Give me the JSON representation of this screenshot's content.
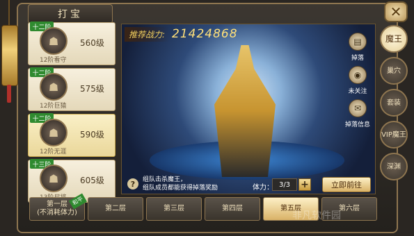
{
  "title": "打宝",
  "close_icon": "x",
  "bosses": [
    {
      "stage": "十二阶",
      "level": "560级",
      "name": "12阶看守",
      "icon": "dark-knight"
    },
    {
      "stage": "十二阶",
      "level": "575级",
      "name": "12阶巨猿",
      "icon": "red-beast"
    },
    {
      "stage": "十二阶",
      "level": "590级",
      "name": "12阶无涯",
      "icon": "golden-sage",
      "selected": true
    },
    {
      "stage": "十三阶",
      "level": "605级",
      "name": "13阶尸将",
      "icon": "undead-general"
    }
  ],
  "scene": {
    "power_label": "推荐战力:",
    "power_value": "21424868",
    "actions": [
      {
        "label": "掉落",
        "icon": "drop-icon"
      },
      {
        "label": "未关注",
        "icon": "eye-icon"
      },
      {
        "label": "掉落信息",
        "icon": "info-icon"
      }
    ],
    "hint_line1": "组队击杀魔王，",
    "hint_line2": "组队成员都能获得掉落奖励",
    "stamina_label": "体力：",
    "stamina_value": "3/3",
    "go_button": "立即前往"
  },
  "right_tabs": [
    {
      "label": "魔王",
      "active": true
    },
    {
      "label": "巢穴"
    },
    {
      "label": "套装"
    },
    {
      "label": "VIP魔王"
    },
    {
      "label": "深渊"
    }
  ],
  "floors": [
    {
      "label": "第一层",
      "sub": "(不消耗体力)",
      "ribbon": "和平"
    },
    {
      "label": "第二层"
    },
    {
      "label": "第三层"
    },
    {
      "label": "第四层"
    },
    {
      "label": "第五层",
      "selected": true
    },
    {
      "label": "第六层"
    }
  ],
  "watermark": "非凡软件园"
}
